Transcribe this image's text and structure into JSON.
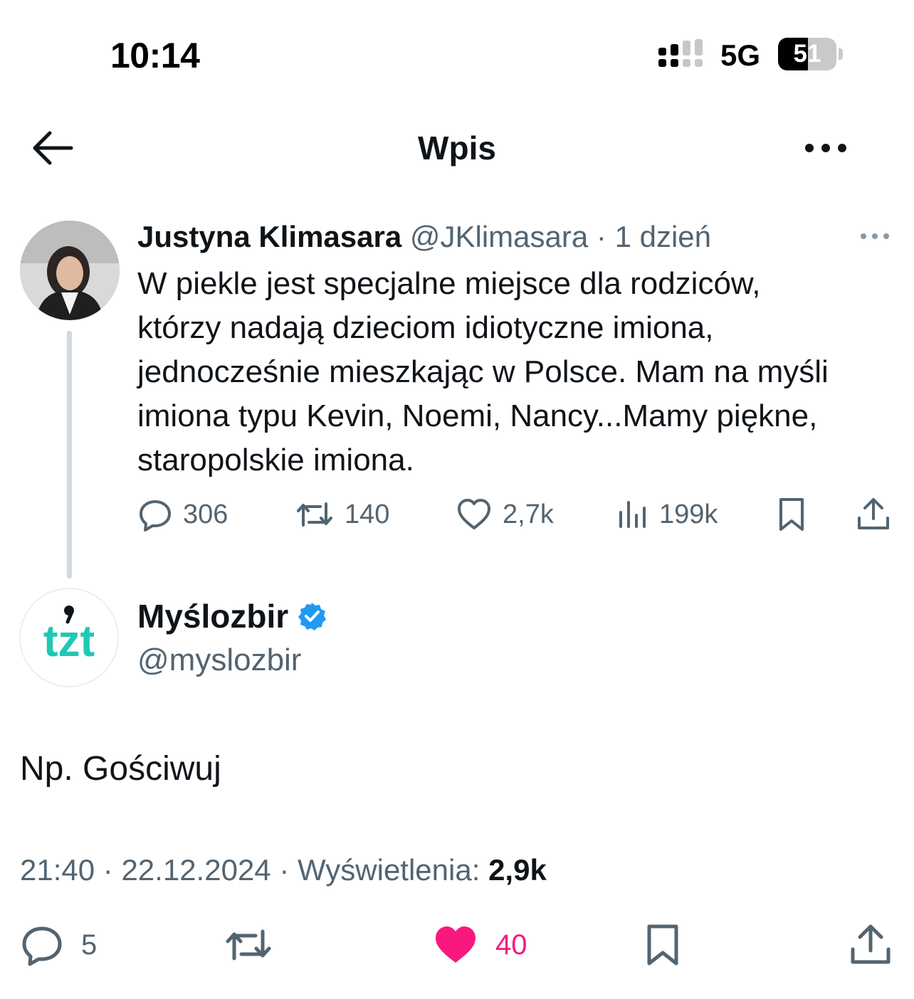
{
  "status_bar": {
    "time": "10:14",
    "network": "5G",
    "battery": "51",
    "battery_level": 0.51
  },
  "header": {
    "title": "Wpis"
  },
  "quoted_tweet": {
    "author_name": "Justyna Klimasara",
    "author_handle": "@JKlimasara",
    "separator": "·",
    "time_ago": "1 dzień",
    "text_lines": [
      "W piekle jest specjalne miejsce dla rodziców,",
      "którzy nadają dzieciom idiotyczne imiona,",
      "jednocześnie mieszkając w Polsce. Mam na myśli",
      "imiona typu Kevin, Noemi, Nancy...Mamy piękne,",
      "staropolskie imiona."
    ],
    "actions": {
      "replies": "306",
      "reposts": "140",
      "likes": "2,7k",
      "views": "199k"
    }
  },
  "reply_tweet": {
    "author_name": "Myślozbir",
    "author_handle": "@myslozbir",
    "verified": true,
    "avatar_logo": "tzt",
    "text": "Np. Gościwuj",
    "time": "21:40",
    "separator": "·",
    "date": "22.12.2024",
    "views_label": "Wyświetlenia:",
    "views_count": "2,9k",
    "actions": {
      "replies": "5",
      "likes": "40",
      "liked": true
    }
  },
  "colors": {
    "text_primary": "#0f1419",
    "text_secondary": "#536471",
    "like_active": "#f91880",
    "verified_blue": "#1d9bf0",
    "logo_teal": "#1fc8b4",
    "thread_line": "#cfd9de"
  },
  "icons": {
    "back": "arrow-left-icon",
    "more": "more-horizontal-icon",
    "reply": "reply-bubble-icon",
    "repost": "repost-icon",
    "like": "heart-icon",
    "views": "analytics-bars-icon",
    "bookmark": "bookmark-icon",
    "share": "share-upload-icon",
    "verified": "verified-badge-icon"
  }
}
